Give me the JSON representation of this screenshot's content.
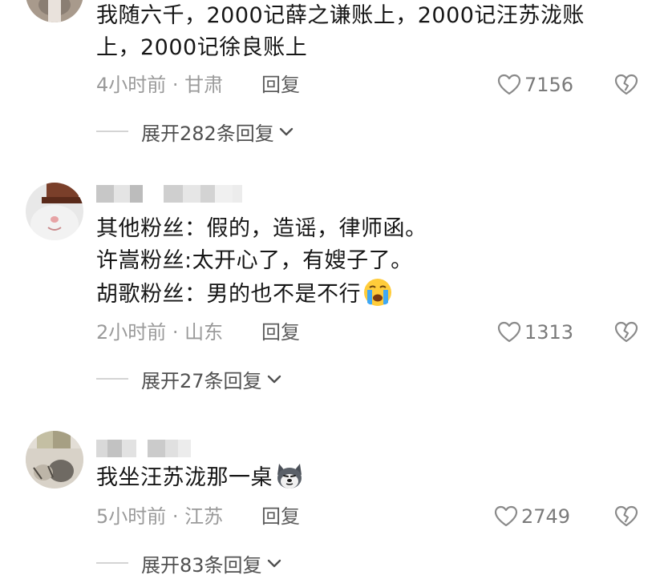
{
  "comments": [
    {
      "text_lines": [
        "我随六千，2000记薛之谦账上，2000记汪苏泷账",
        "上，2000记徐良账上"
      ],
      "time_location": "4小时前 · 甘肃",
      "reply_label": "回复",
      "likes": "7156",
      "expand_label": "展开282条回复"
    },
    {
      "text_lines": [
        "其他粉丝：假的，造谣，律师函。",
        "许嵩粉丝:太开心了，有嫂子了。",
        "胡歌粉丝：男的也不是不行"
      ],
      "time_location": "2小时前 · 山东",
      "reply_label": "回复",
      "likes": "1313",
      "expand_label": "展开27条回复"
    },
    {
      "text_lines": [
        "我坐汪苏泷那一桌"
      ],
      "time_location": "5小时前 · 江苏",
      "reply_label": "回复",
      "likes": "2749",
      "expand_label": "展开83条回复"
    }
  ],
  "icons": {
    "like": "heart-outline-icon",
    "dislike": "broken-heart-icon",
    "expand": "chevron-down-icon",
    "emoji_cry": "loudly-crying-face-emoji",
    "emoji_dog": "husky-dog-face-emoji"
  },
  "colors": {
    "text": "#161616",
    "meta": "#9a9a9a",
    "reply": "#5c5c5c",
    "expand": "#505050"
  }
}
